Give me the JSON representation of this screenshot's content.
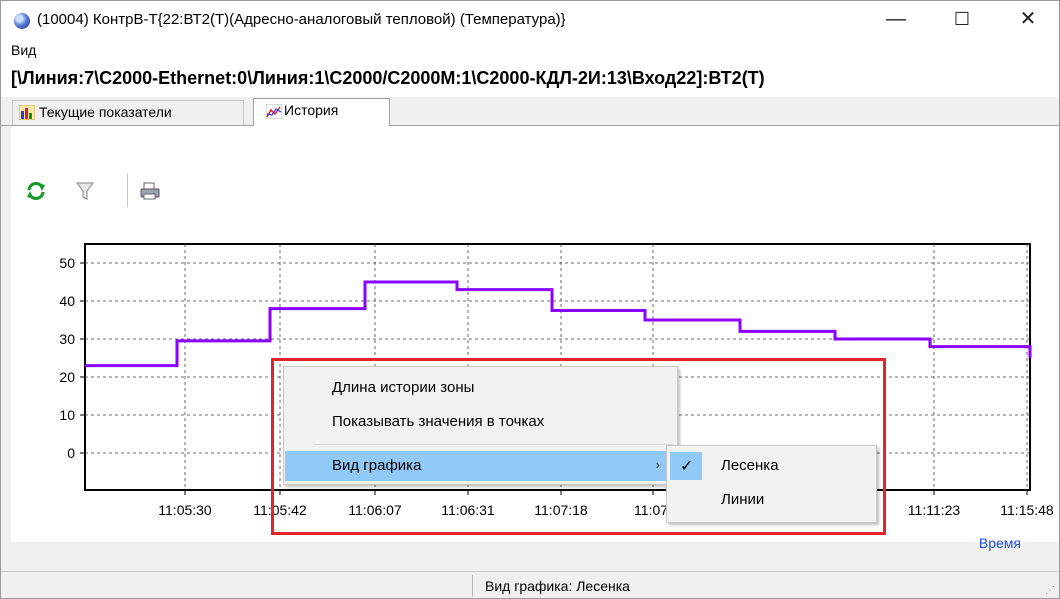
{
  "window": {
    "title": "(10004) КонтрВ-Т{22:ВТ2(Т)(Адресно-аналоговый тепловой) (Температура)}",
    "controls": {
      "minimize": "—",
      "maximize": "☐",
      "close": "✕"
    }
  },
  "menu": {
    "items": [
      "Вид"
    ]
  },
  "path": "[\\Линия:7\\С2000-Ethernet:0\\Линия:1\\С2000/С2000М:1\\С2000-КДЛ-2И:13\\Вход22]:ВТ2(Т)",
  "tabs": [
    {
      "label": "Текущие показатели",
      "icon": "bar-chart-icon"
    },
    {
      "label": "История",
      "icon": "line-chart-icon"
    }
  ],
  "toolbar": {
    "icons": [
      "refresh-icon",
      "filter-icon",
      "print-icon"
    ]
  },
  "chart_data": {
    "type": "line",
    "style": "step",
    "color": "#8b00ff",
    "x_ticks": [
      "11:05:30",
      "11:05:42",
      "11:06:07",
      "11:06:31",
      "11:07:18",
      "11:07:",
      "11:11:23",
      "11:15:48"
    ],
    "y_ticks": [
      0,
      10,
      20,
      30,
      40,
      50
    ],
    "ylim": [
      -10,
      55
    ],
    "xlabel": "Время",
    "grid": true,
    "steps": [
      {
        "value": 23,
        "x_start": 0,
        "x_end": 92
      },
      {
        "value": 29.5,
        "x_start": 92,
        "x_end": 185
      },
      {
        "value": 38,
        "x_start": 185,
        "x_end": 280
      },
      {
        "value": 45,
        "x_start": 280,
        "x_end": 372
      },
      {
        "value": 43,
        "x_start": 372,
        "x_end": 467
      },
      {
        "value": 37.5,
        "x_start": 467,
        "x_end": 560
      },
      {
        "value": 35,
        "x_start": 560,
        "x_end": 655
      },
      {
        "value": 32,
        "x_start": 655,
        "x_end": 750
      },
      {
        "value": 30,
        "x_start": 750,
        "x_end": 845
      },
      {
        "value": 28,
        "x_start": 845,
        "x_end": 945
      }
    ],
    "x_units": "chart-relative, 0..945",
    "end_value": 25
  },
  "context_menu": {
    "items": [
      "Длина истории зоны",
      "Показывать значения в точках",
      "Вид графика"
    ],
    "submenu": {
      "items": [
        "Лесенка",
        "Линии"
      ],
      "checked": "Лесенка"
    }
  },
  "status": {
    "text": "Вид графика: Лесенка"
  }
}
